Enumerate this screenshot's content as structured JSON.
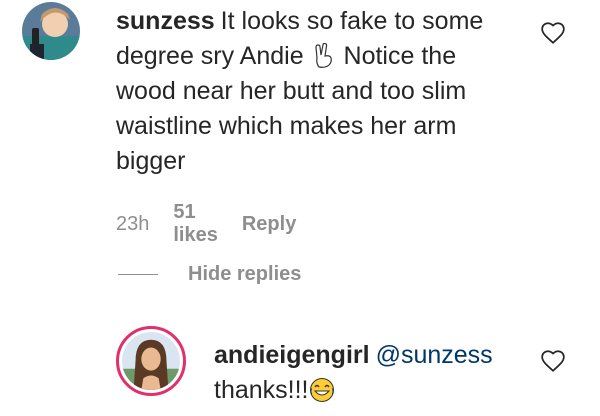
{
  "comment": {
    "username": "sunzess",
    "text": "It looks so fake to some degree sry Andie",
    "text_after_emoji": "Notice the wood near her butt and too slim waistline which makes her arm bigger",
    "emoji": "victory-hand-emoji",
    "time": "23h",
    "likes": "51 likes",
    "reply": "Reply"
  },
  "replies_toggle": {
    "label": "Hide replies"
  },
  "reply_comment": {
    "username": "andieigengirl",
    "mention": "@sunzess",
    "text": "thanks!!!",
    "emoji": "face-with-tears-of-joy-emoji"
  },
  "colors": {
    "muted": "#8e8e8e",
    "mention": "#00376b",
    "text": "#262626"
  }
}
